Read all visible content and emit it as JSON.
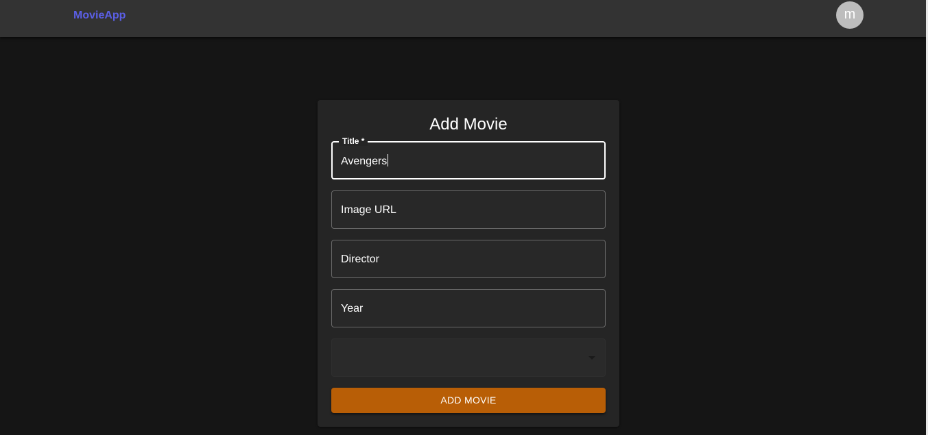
{
  "appbar": {
    "brand": "MovieApp",
    "avatar_letter": "m"
  },
  "form": {
    "title": "Add Movie",
    "fields": {
      "title": {
        "label": "Title *",
        "value": "Avengers"
      },
      "image_url": {
        "placeholder": "Image URL"
      },
      "director": {
        "placeholder": "Director"
      },
      "year": {
        "placeholder": "Year"
      },
      "select": {
        "value": "",
        "icon": "arrow-drop-down"
      }
    },
    "submit_label": "ADD MOVIE"
  },
  "colors": {
    "brand": "#5b5fe6",
    "button": "#b85e06",
    "background": "#151515",
    "appbar": "#333333",
    "card": "#252525"
  }
}
